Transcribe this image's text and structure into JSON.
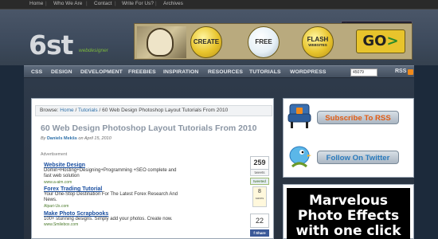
{
  "topnav": {
    "items": [
      "Home",
      "Who We Are",
      "Contact",
      "Write For Us?",
      "Archives"
    ],
    "search_placeholder": "Search this site..."
  },
  "logo": {
    "word": "6st",
    "sub": "webdesigner"
  },
  "banner": {
    "badges": [
      {
        "line1": "CREATE",
        "line2": ""
      },
      {
        "line1": "FREE",
        "line2": ""
      },
      {
        "line1": "FLASH",
        "line2": "WEBSITES"
      }
    ],
    "go": "GO"
  },
  "mainnav": {
    "items": [
      "CSS",
      "DESIGN",
      "DEVELOPMENT",
      "FREEBIES",
      "INSPIRATION",
      "RESOURCES",
      "TUTORIALS",
      "WORDPRESS"
    ],
    "readers": "45079 readers",
    "rss": "RSS"
  },
  "colors": {
    "accent": "#2d6fa8",
    "nav_bg": "#4f5b6b",
    "rss_orange": "#e25c14",
    "twitter_blue": "#2a7bbd"
  },
  "article": {
    "breadcrumb": {
      "prefix": "Browse:",
      "home": "Home",
      "sep1": "/",
      "section": "Tutorials",
      "sep2": "/",
      "current": "60 Web Design Photoshop Layout Tutorials From 2010"
    },
    "title": "60 Web Design Photoshop Layout Tutorials From 2010",
    "byline_prefix": "By",
    "author": "Daniels Mekšs",
    "date": "on April 15, 2010",
    "ad_label": "Advertisement",
    "ads": [
      {
        "title": "Website Design",
        "desc": "Domin+Hosting+Designing+Programming +SEO complete and fast web solution",
        "url": "www.a-aim.com"
      },
      {
        "title": "Forex Trading Tutorial",
        "desc": "Your One-Stop Destination For The Latest Forex Research And News.",
        "url": "Alpari-Us.com"
      },
      {
        "title": "Make Photo Scrapbooks",
        "desc": "100+ stunning designs. Simply add your photos. Create now.",
        "url": "www.Smilebox.com"
      }
    ],
    "share": {
      "tweets_count": "259",
      "tweets_label": "tweets",
      "retweet_label": "tweeted",
      "delicious_count": "8",
      "delicious_label": "saves",
      "facebook_count": "22",
      "facebook_label": "f Share"
    }
  },
  "sidebar": {
    "rss_button": "Subscribe To RSS",
    "twitter_button": "Follow On Twitter",
    "promo_lines": [
      "Marvelous",
      "Photo Effects",
      "with one click"
    ]
  }
}
